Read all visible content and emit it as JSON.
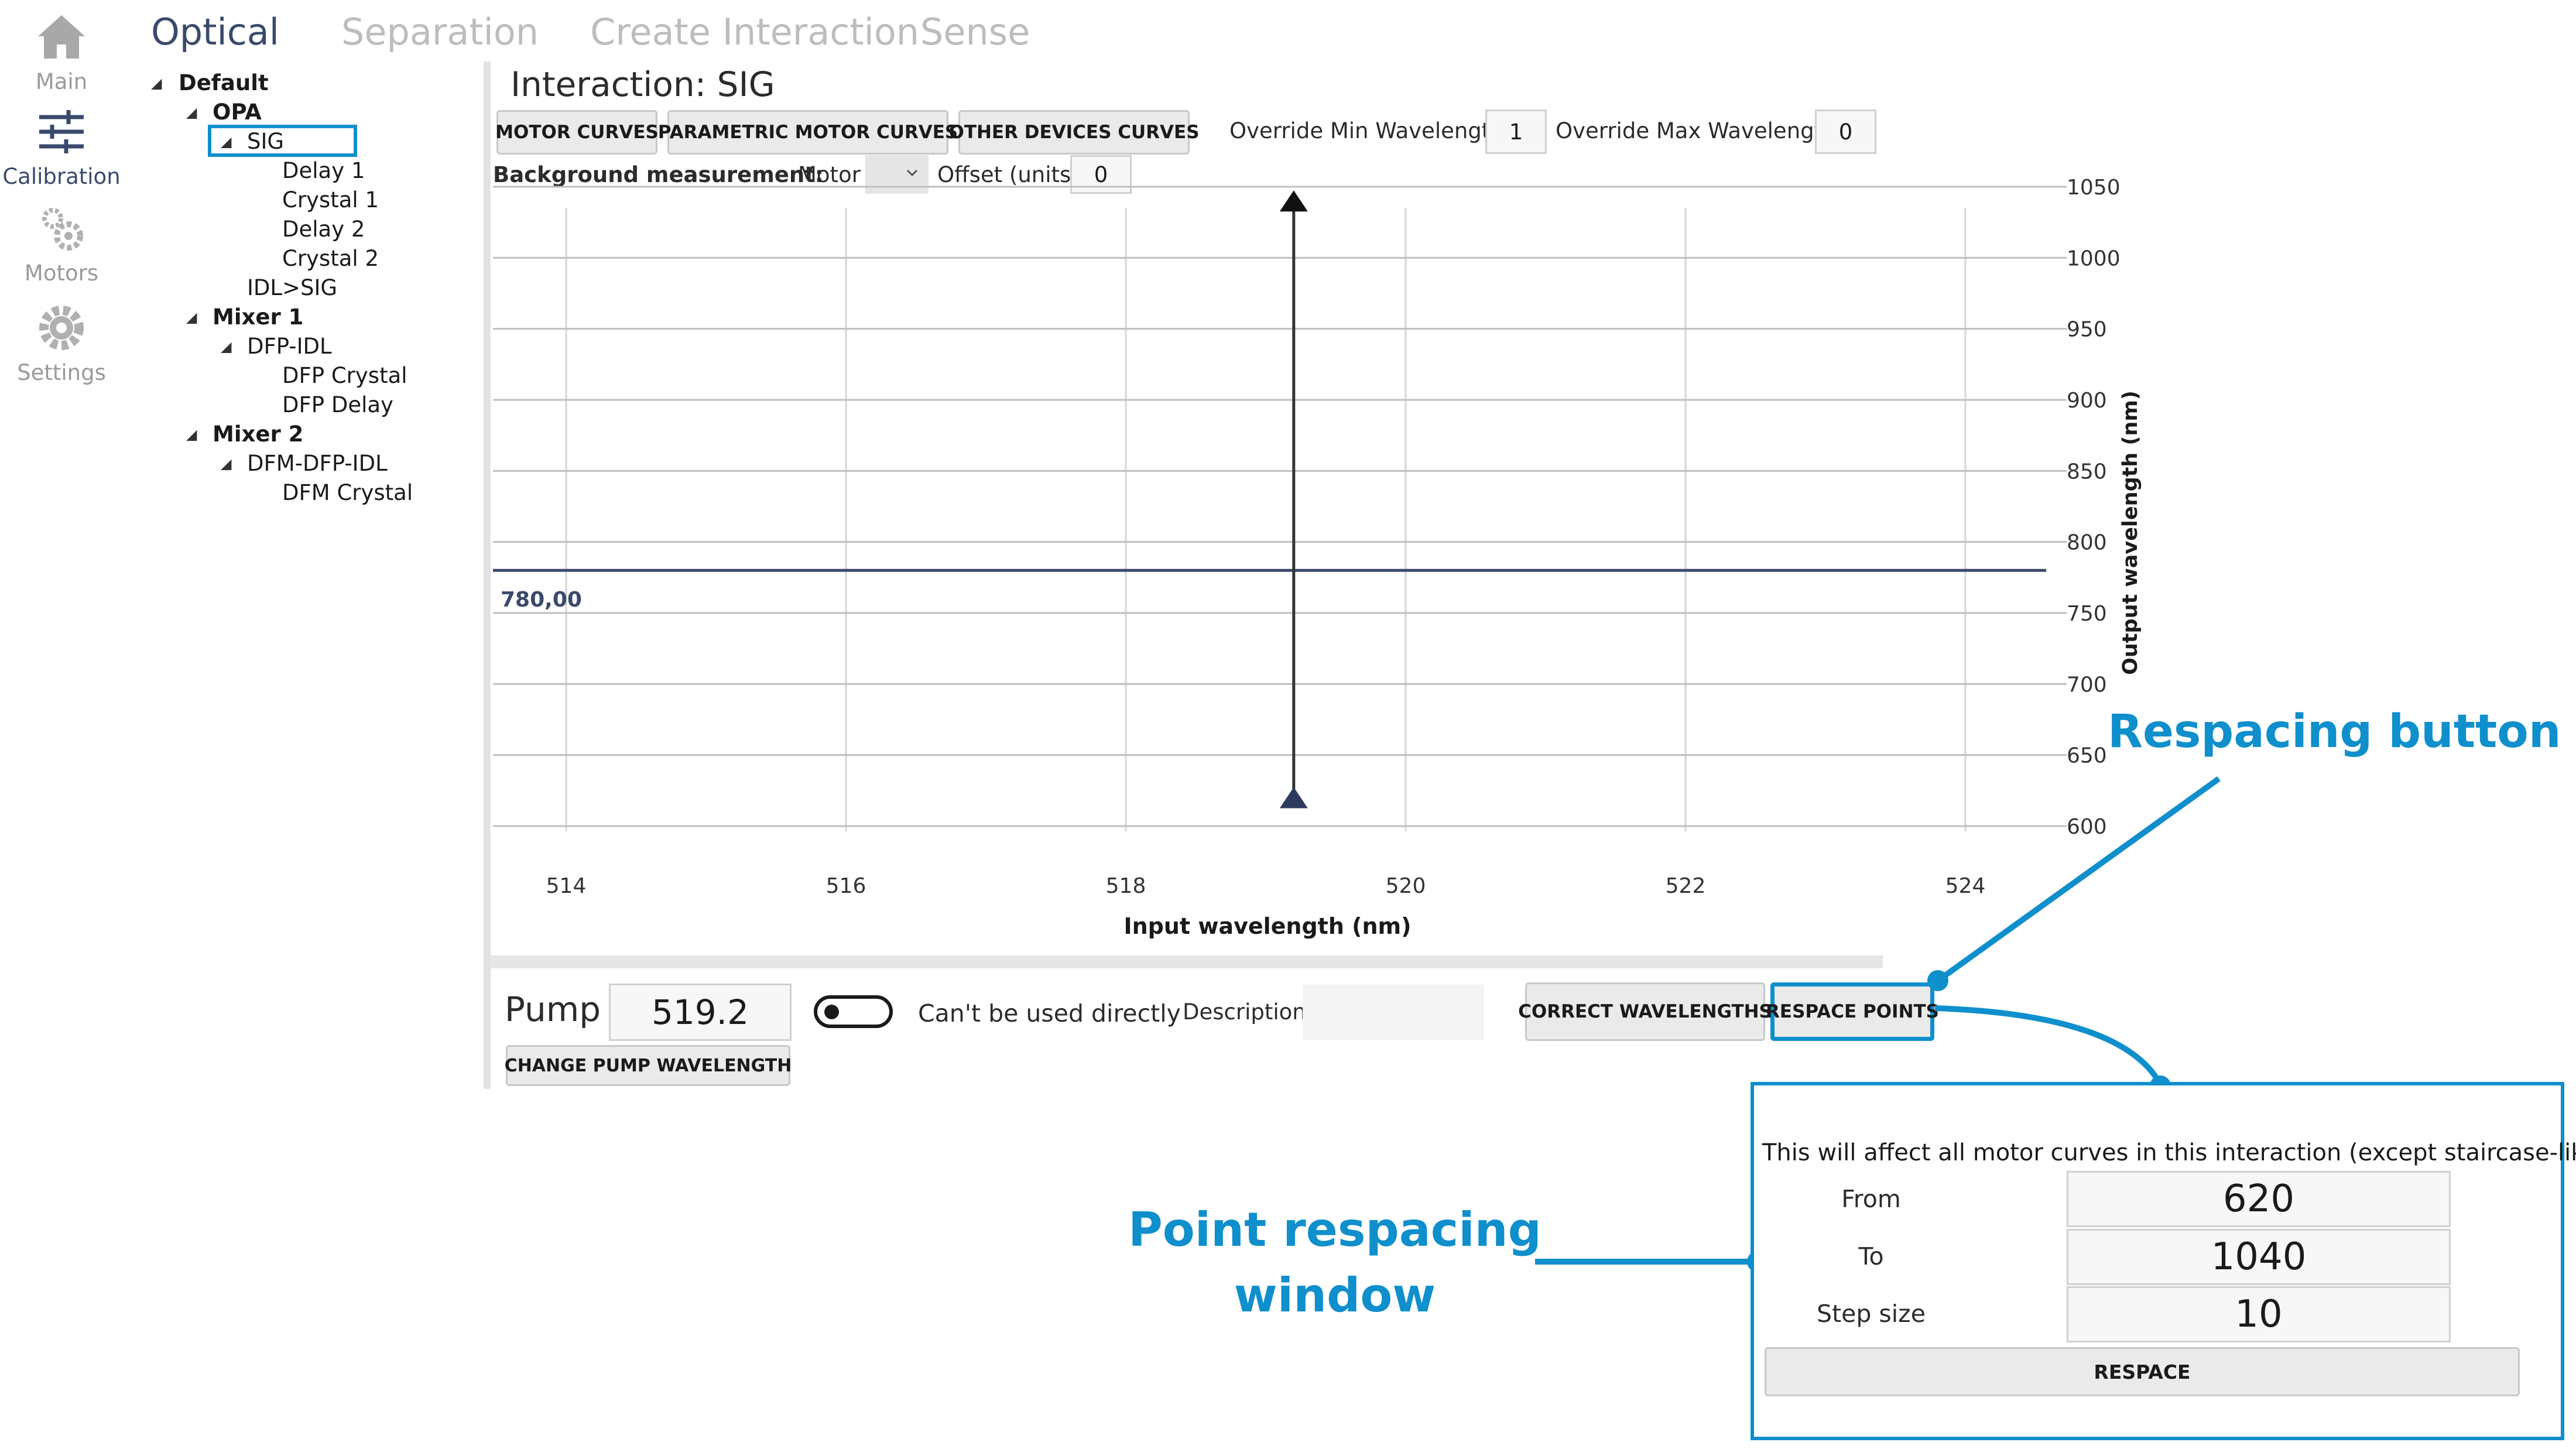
{
  "nav": {
    "items": [
      {
        "label": "Main",
        "icon": "home-icon",
        "active": false
      },
      {
        "label": "Calibration",
        "icon": "sliders-icon",
        "active": true
      },
      {
        "label": "Motors",
        "icon": "gears-icon",
        "active": false
      },
      {
        "label": "Settings",
        "icon": "gear-icon",
        "active": false
      }
    ]
  },
  "tabs": [
    "Optical",
    "Separation",
    "Create Interaction",
    "Sense"
  ],
  "tree": {
    "root": "Default",
    "opa": "OPA",
    "sig": "SIG",
    "delay1": "Delay 1",
    "crystal1": "Crystal 1",
    "delay2": "Delay 2",
    "crystal2": "Crystal 2",
    "idlsig": "IDL>SIG",
    "mixer1": "Mixer 1",
    "dfpidl": "DFP-IDL",
    "dfpcrystal": "DFP Crystal",
    "dfpdelay": "DFP Delay",
    "mixer2": "Mixer 2",
    "dfmdfpidl": "DFM-DFP-IDL",
    "dfmcrystal": "DFM Crystal"
  },
  "interaction": {
    "title": "Interaction: SIG",
    "buttons": {
      "motor_curves": "MOTOR CURVES",
      "parametric": "PARAMETRIC MOTOR CURVES",
      "other_devices": "OTHER DEVICES CURVES"
    },
    "override_min_label": "Override Min Wavelength",
    "override_min_value": "1",
    "override_max_label": "Override Max Wavelength",
    "override_max_value": "0",
    "background_label": "Background measurement:",
    "motor_select": "Motor",
    "offset_label": "Offset (units)",
    "offset_value": "0"
  },
  "chart_data": {
    "type": "line",
    "xlabel": "Input wavelength (nm)",
    "ylabel": "Output wavelength (nm)",
    "xlim": [
      513.5,
      525
    ],
    "ylim": [
      590,
      1060
    ],
    "x_ticks": [
      514,
      516,
      518,
      520,
      522,
      524
    ],
    "y_ticks": [
      600,
      650,
      700,
      750,
      800,
      850,
      900,
      950,
      1000,
      1050
    ],
    "grid": true,
    "horizontal_line": {
      "y": 780,
      "label": "780,00"
    },
    "vertical_marker": {
      "x": 519.2,
      "y_min": 620,
      "y_max": 1040
    }
  },
  "bottom": {
    "pump_label": "Pump",
    "pump_value": "519.2",
    "change_pump": "CHANGE PUMP WAVELENGTH",
    "toggle_label": "Can't be used directly",
    "description_label": "Description:",
    "description_value": "",
    "correct_wavelengths": "CORRECT WAVELENGTHS",
    "respace_points": "RESPACE POINTS"
  },
  "respace_popup": {
    "info": "This will affect all motor curves in this interaction (except staircase-like)",
    "from_label": "From",
    "from_value": "620",
    "to_label": "To",
    "to_value": "1040",
    "step_label": "Step size",
    "step_value": "10",
    "button": "RESPACE"
  },
  "annotations": {
    "respacing_button": "Respacing button",
    "window_line1": "Point respacing",
    "window_line2": "window"
  },
  "colors": {
    "accent": "#0f8fcc",
    "nav_active": "#3a4a6d",
    "chart_line": "#3a4a6d"
  }
}
